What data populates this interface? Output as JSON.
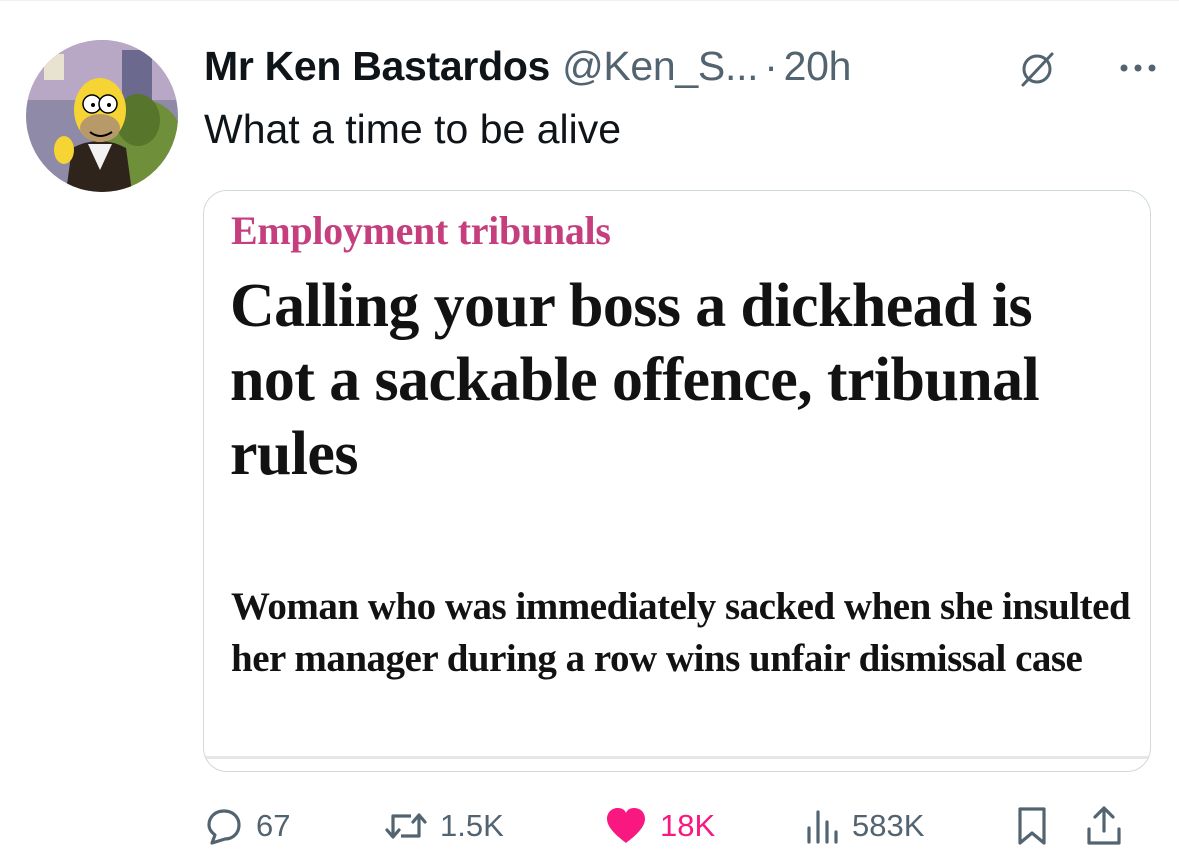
{
  "tweet": {
    "display_name": "Mr Ken Bastardos",
    "handle": "@Ken_S...",
    "separator": "·",
    "time": "20h",
    "text": "What a time to be alive",
    "avatar": "cartoon-avatar-image"
  },
  "card": {
    "kicker": "Employment tribunals",
    "headline": "Calling your boss a dickhead is not a sackable offence, tribunal rules",
    "standfirst": "Woman who was immediately sacked when she insulted her manager during a row wins unfair dismissal case"
  },
  "actions": {
    "replies": "67",
    "reposts": "1.5K",
    "likes": "18K",
    "views": "583K",
    "liked": true
  },
  "icons": {
    "grok": "grok-slash-icon",
    "more": "more-dots-icon",
    "reply": "reply-bubble-icon",
    "repost": "repost-icon",
    "like": "heart-icon",
    "views": "views-chart-icon",
    "bookmark": "bookmark-icon",
    "share": "share-icon"
  },
  "colors": {
    "like_accent": "#f91880",
    "secondary_text": "#536471",
    "kicker": "#c53f7e"
  }
}
